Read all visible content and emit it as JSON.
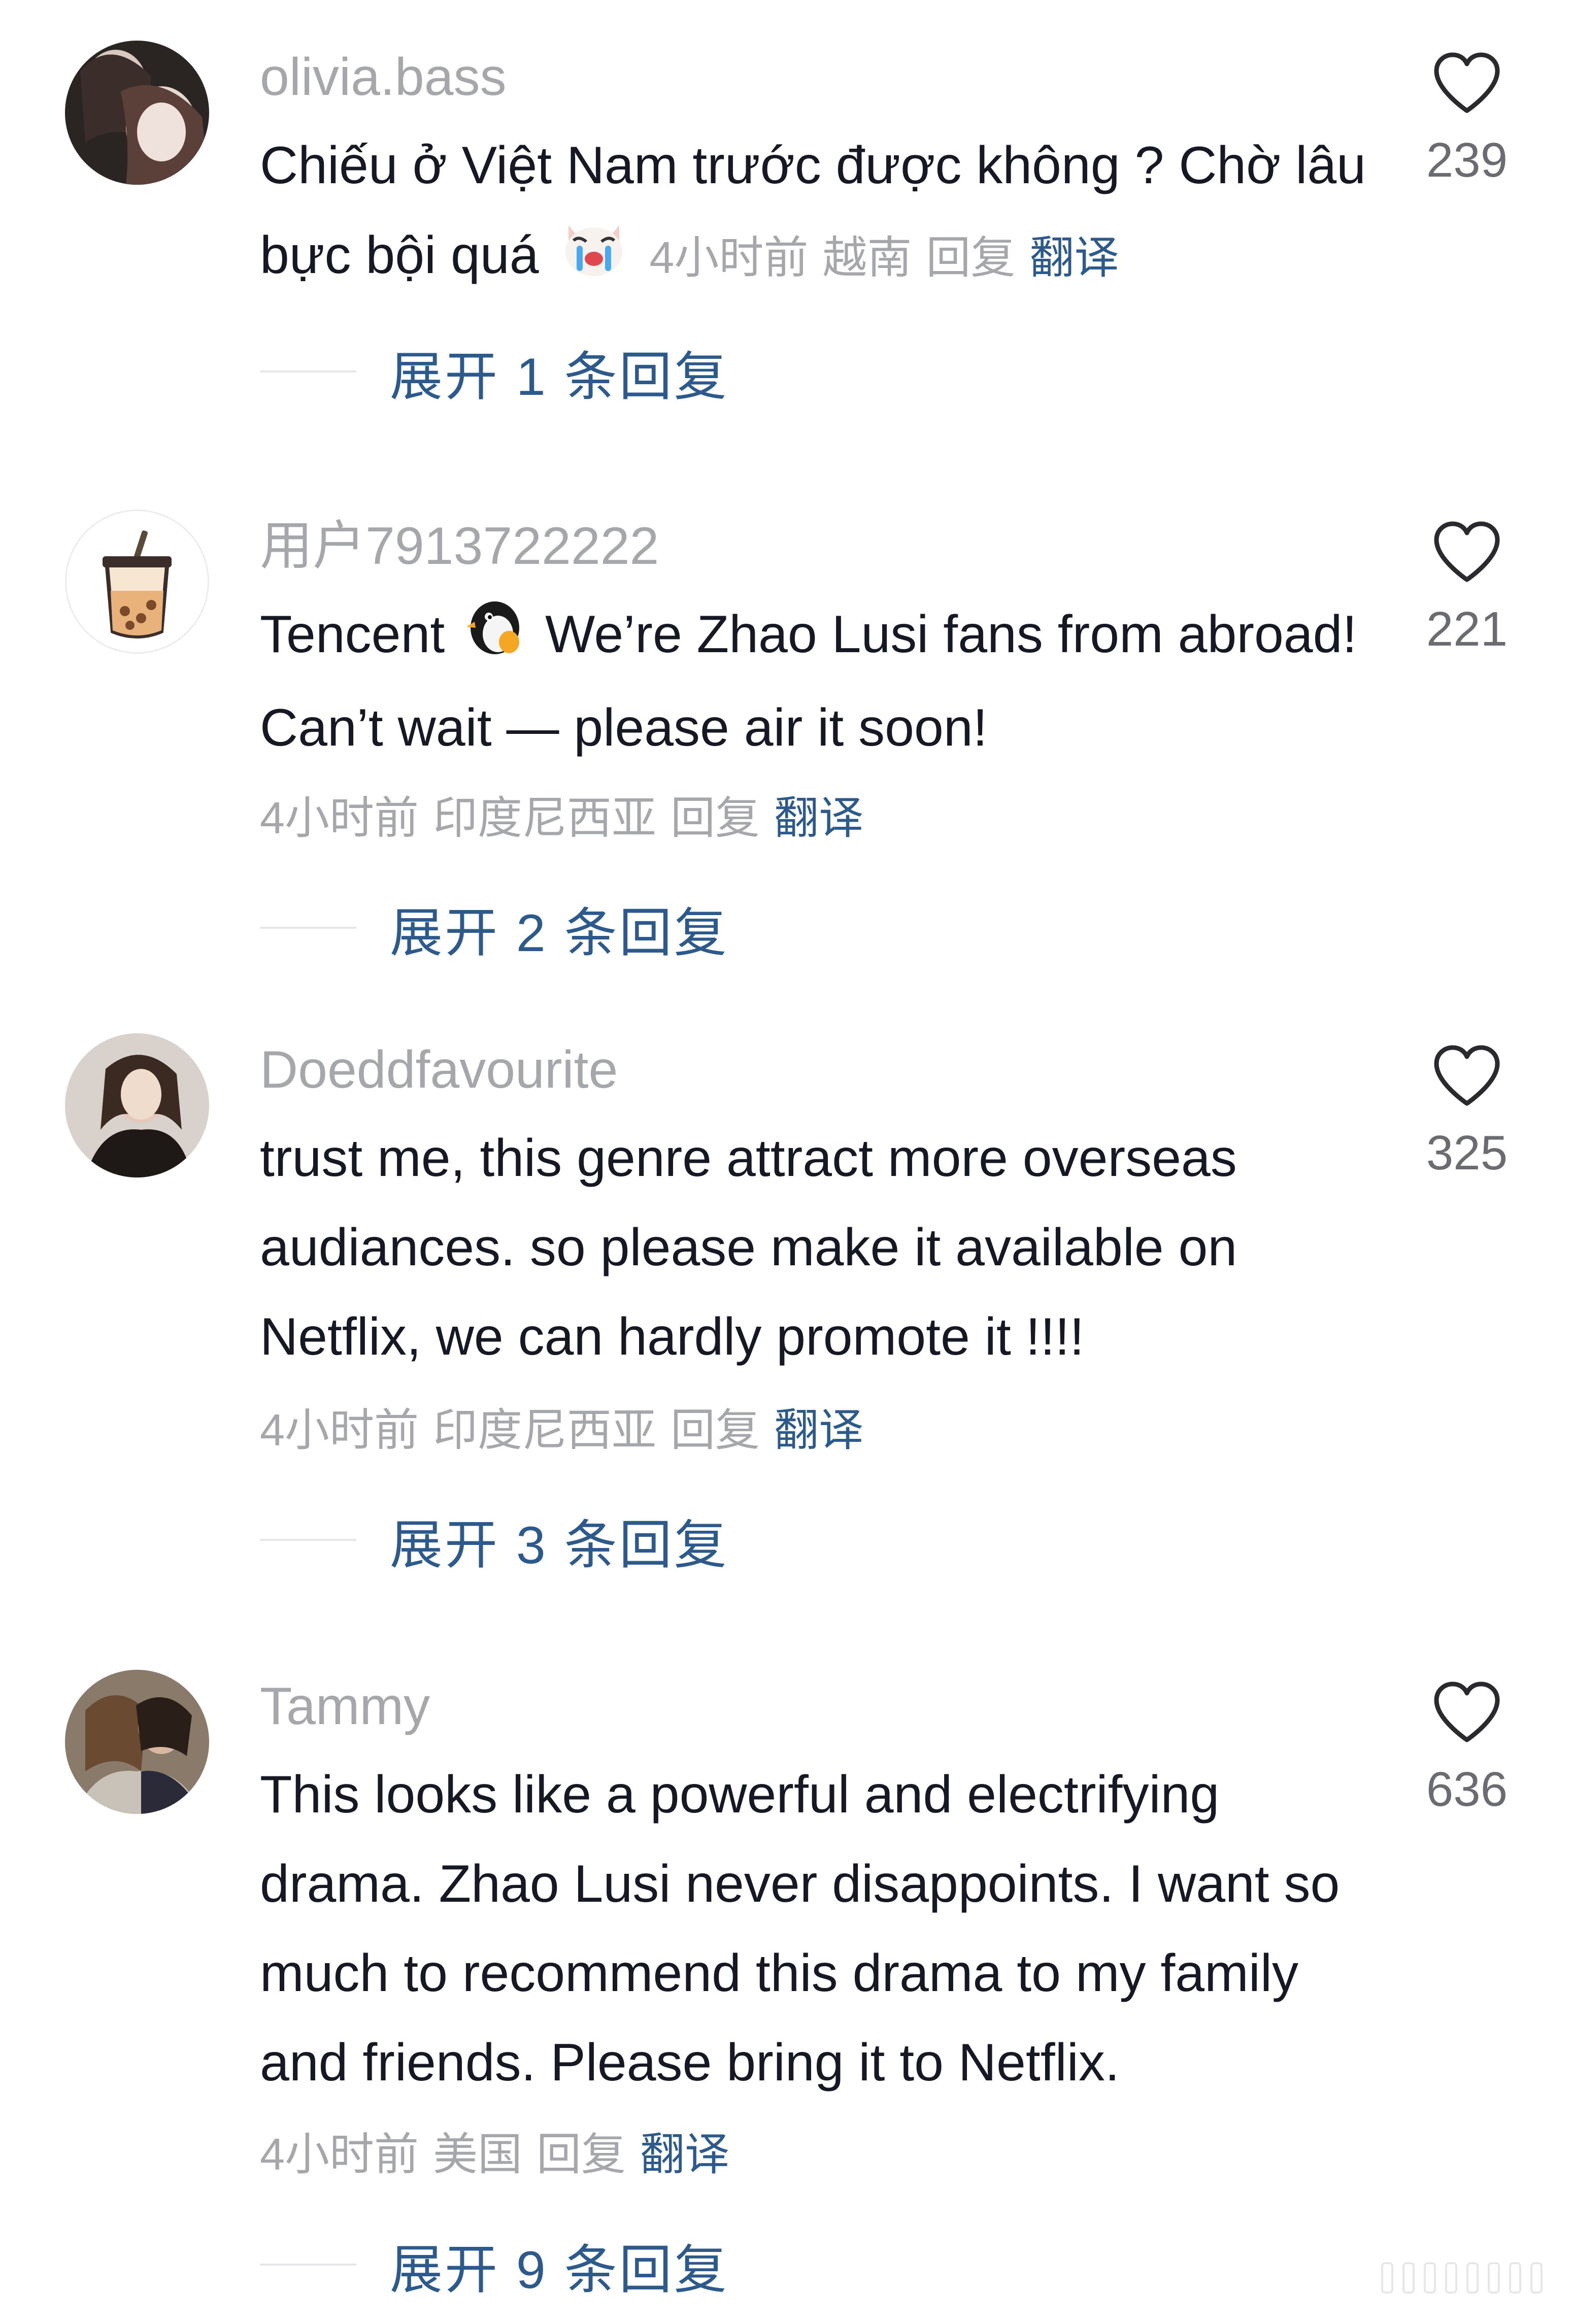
{
  "comments": [
    {
      "username": "olivia.bass",
      "text": "Chiếu ở Việt Nam trước được không ? Chờ lâu bực bội quá",
      "emoji": "crying-dog-emoji",
      "time": "4小时前",
      "location": "越南",
      "reply": "回复",
      "translate": "翻译",
      "likes": "239",
      "expand": "展开 1 条回复"
    },
    {
      "username": "用户7913722222",
      "text_prefix": "Tencent",
      "emoji": "penguin-emoji",
      "text": "We’re Zhao Lusi fans from abroad! Can’t wait — please air it soon!",
      "time": "4小时前",
      "location": "印度尼西亚",
      "reply": "回复",
      "translate": "翻译",
      "likes": "221",
      "expand": "展开 2 条回复"
    },
    {
      "username": "Doeddfavourite",
      "text": "trust me, this genre attract more overseas audiances. so please make it available on Netflix, we can hardly promote it !!!!",
      "time": "4小时前",
      "location": "印度尼西亚",
      "reply": "回复",
      "translate": "翻译",
      "likes": "325",
      "expand": "展开 3 条回复"
    },
    {
      "username": "Tammy",
      "text": "This looks like a powerful and electrifying drama. Zhao Lusi never disappoints. I want so much to recommend this drama to my family and friends. Please bring it to Netflix.",
      "time": "4小时前",
      "location": "美国",
      "reply": "回复",
      "translate": "翻译",
      "likes": "636",
      "expand": "展开 9 条回复"
    }
  ],
  "icons": {
    "like": "heart-outline-icon",
    "avatar_2": "bubble-tea-icon"
  },
  "colors": {
    "username": "#a6a7ab",
    "text": "#161823",
    "link": "#2d5a8c",
    "meta": "#a6a7ab"
  }
}
